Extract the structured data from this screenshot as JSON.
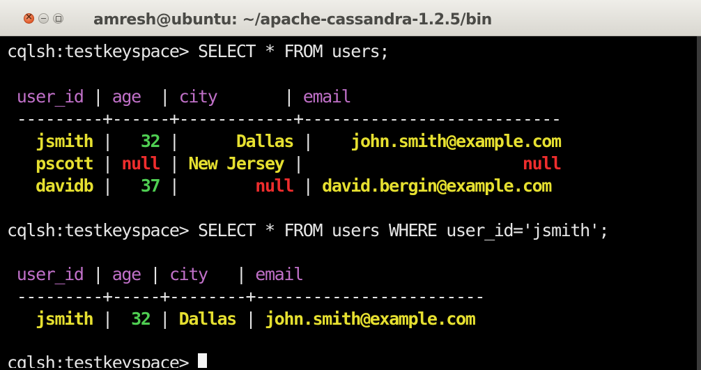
{
  "window": {
    "title": "amresh@ubuntu: ~/apache-cassandra-1.2.5/bin"
  },
  "terminal": {
    "prompt": "cqlsh:testkeyspace> ",
    "command1": "SELECT * FROM users;",
    "table1": {
      "header": [
        " user_id",
        "age",
        "city",
        "email"
      ],
      "separator": " ---------+------+------------+---------------------------",
      "rows": [
        {
          "user_id": "   jsmith",
          "age": "   32",
          "city": "      Dallas",
          "email": "    john.smith@example.com"
        },
        {
          "user_id": "   pscott",
          "age": " null",
          "city": " New Jersey",
          "email": "                       null"
        },
        {
          "user_id": "   davidb",
          "age": "   37",
          "city": "        null",
          "email": " david.bergin@example.com"
        }
      ]
    },
    "command2": "SELECT * FROM users WHERE user_id='jsmith';",
    "table2": {
      "header": [
        " user_id",
        "age",
        "city",
        "email"
      ],
      "separator": " ---------+-----+--------+------------------------",
      "rows": [
        {
          "user_id": "   jsmith",
          "age": "  32",
          "city": " Dallas",
          "email": " john.smith@example.com"
        }
      ]
    }
  },
  "colors": {
    "background": "#000000",
    "header": "#c070c8",
    "text_value": "#e6e030",
    "number_value": "#4fce52",
    "null_value": "#ef2d2d"
  }
}
